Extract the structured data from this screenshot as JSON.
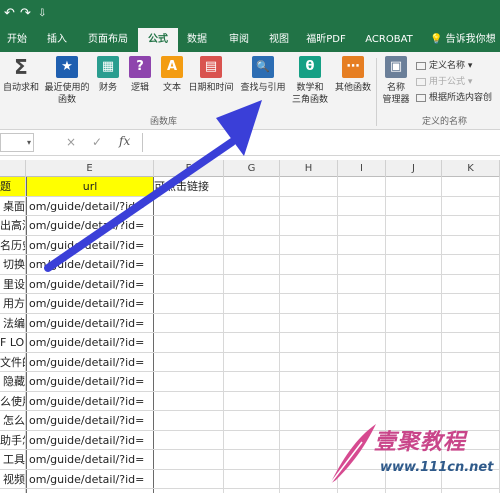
{
  "quick_access": {
    "undo": "↶",
    "redo": "↷",
    "customize": "⇩"
  },
  "tabs": [
    "开始",
    "插入",
    "页面布局",
    "公式",
    "数据",
    "审阅",
    "视图",
    "福昕PDF",
    "ACROBAT"
  ],
  "active_tab": "公式",
  "tell_me": "告诉我你想",
  "ribbon": {
    "buttons": [
      {
        "label": "自动求和",
        "icon": "Σ"
      },
      {
        "label": "最近使用的\n函数",
        "icon": "★"
      },
      {
        "label": "财务",
        "icon": "▦"
      },
      {
        "label": "逻辑",
        "icon": "?"
      },
      {
        "label": "文本",
        "icon": "A"
      },
      {
        "label": "日期和时间",
        "icon": "▤"
      },
      {
        "label": "查找与引用",
        "icon": "🔍"
      },
      {
        "label": "数学和\n三角函数",
        "icon": "θ"
      },
      {
        "label": "其他函数",
        "icon": "⋯"
      },
      {
        "label": "名称\n管理器",
        "icon": "▣"
      }
    ],
    "group_library": "函数库",
    "group_names": "定义的名称",
    "define_name": "定义名称",
    "use_in_formula": "用于公式",
    "create_from_selection": "根据所选内容创"
  },
  "formula_bar": {
    "cancel": "×",
    "enter": "✓",
    "fx": "fx",
    "value": ""
  },
  "columns": [
    "E",
    "F",
    "G",
    "H",
    "I",
    "J",
    "K"
  ],
  "header_row": {
    "d": "题",
    "e": "url",
    "f": "可点击链接"
  },
  "rows": [
    {
      "d": "桌面",
      "e": "om/guide/detail/?id="
    },
    {
      "d": "出高清",
      "e": "om/guide/detail/?id="
    },
    {
      "d": "名历史",
      "e": "om/guide/detail/?id="
    },
    {
      "d": "切换",
      "e": "om/guide/detail/?id="
    },
    {
      "d": "里设",
      "e": "om/guide/detail/?id="
    },
    {
      "d": "用方",
      "e": "om/guide/detail/?id="
    },
    {
      "d": "法编",
      "e": "om/guide/detail/?id="
    },
    {
      "d": "F LOL",
      "e": "om/guide/detail/?id="
    },
    {
      "d": "文件的",
      "e": "om/guide/detail/?id="
    },
    {
      "d": "隐藏",
      "e": "om/guide/detail/?id="
    },
    {
      "d": "么使用",
      "e": "om/guide/detail/?id="
    },
    {
      "d": "怎么",
      "e": "om/guide/detail/?id="
    },
    {
      "d": "助手怎",
      "e": "om/guide/detail/?id="
    },
    {
      "d": "工具",
      "e": "om/guide/detail/?id="
    },
    {
      "d": "视频",
      "e": "om/guide/detail/?id="
    },
    {
      "d": "",
      "e": ""
    }
  ],
  "watermark": {
    "main": "壹聚教程",
    "url": "www.111cn.net"
  },
  "arrow_color": "#3a3fd8",
  "theme": {
    "green": "#217346",
    "yellow": "#ffff00"
  }
}
